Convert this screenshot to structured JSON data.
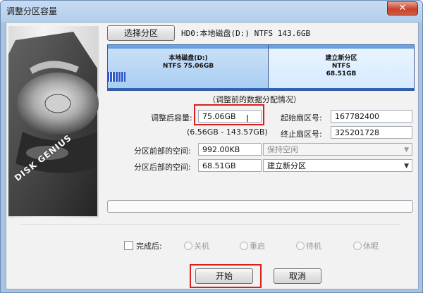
{
  "window": {
    "title": "调整分区容量",
    "close_label": "✕"
  },
  "logo": {
    "brand_text": "DISK GENIUS"
  },
  "toolbar": {
    "select_partition_label": "选择分区"
  },
  "disk": {
    "label": "HD0:本地磁盘(D:) NTFS 143.6GB"
  },
  "partitions": [
    {
      "name": "本地磁盘(D:)",
      "fs": "NTFS 75.06GB"
    },
    {
      "name": "建立新分区",
      "fs": "NTFS",
      "size": "68.51GB"
    }
  ],
  "form": {
    "section_title": "（调整前的数据分配情况）",
    "resized_capacity_label": "调整后容量:",
    "resized_capacity_value": "75.06GB",
    "range_hint": "(6.56GB - 143.57GB)",
    "start_sector_label": "起始扇区号:",
    "start_sector_value": "167782400",
    "end_sector_label": "终止扇区号:",
    "end_sector_value": "325201728",
    "front_space_label": "分区前部的空间:",
    "front_space_value": "992.00KB",
    "front_option_value": "保持空闲",
    "rear_space_label": "分区后部的空间:",
    "rear_space_value": "68.51GB",
    "rear_option_value": "建立新分区"
  },
  "after_done": {
    "label": "完成后:",
    "options": [
      "关机",
      "重启",
      "待机",
      "休眠"
    ]
  },
  "buttons": {
    "start_label": "开始",
    "cancel_label": "取消"
  },
  "colors": {
    "highlight": "#d8211f",
    "partition_blue": "#2d6fc4"
  }
}
